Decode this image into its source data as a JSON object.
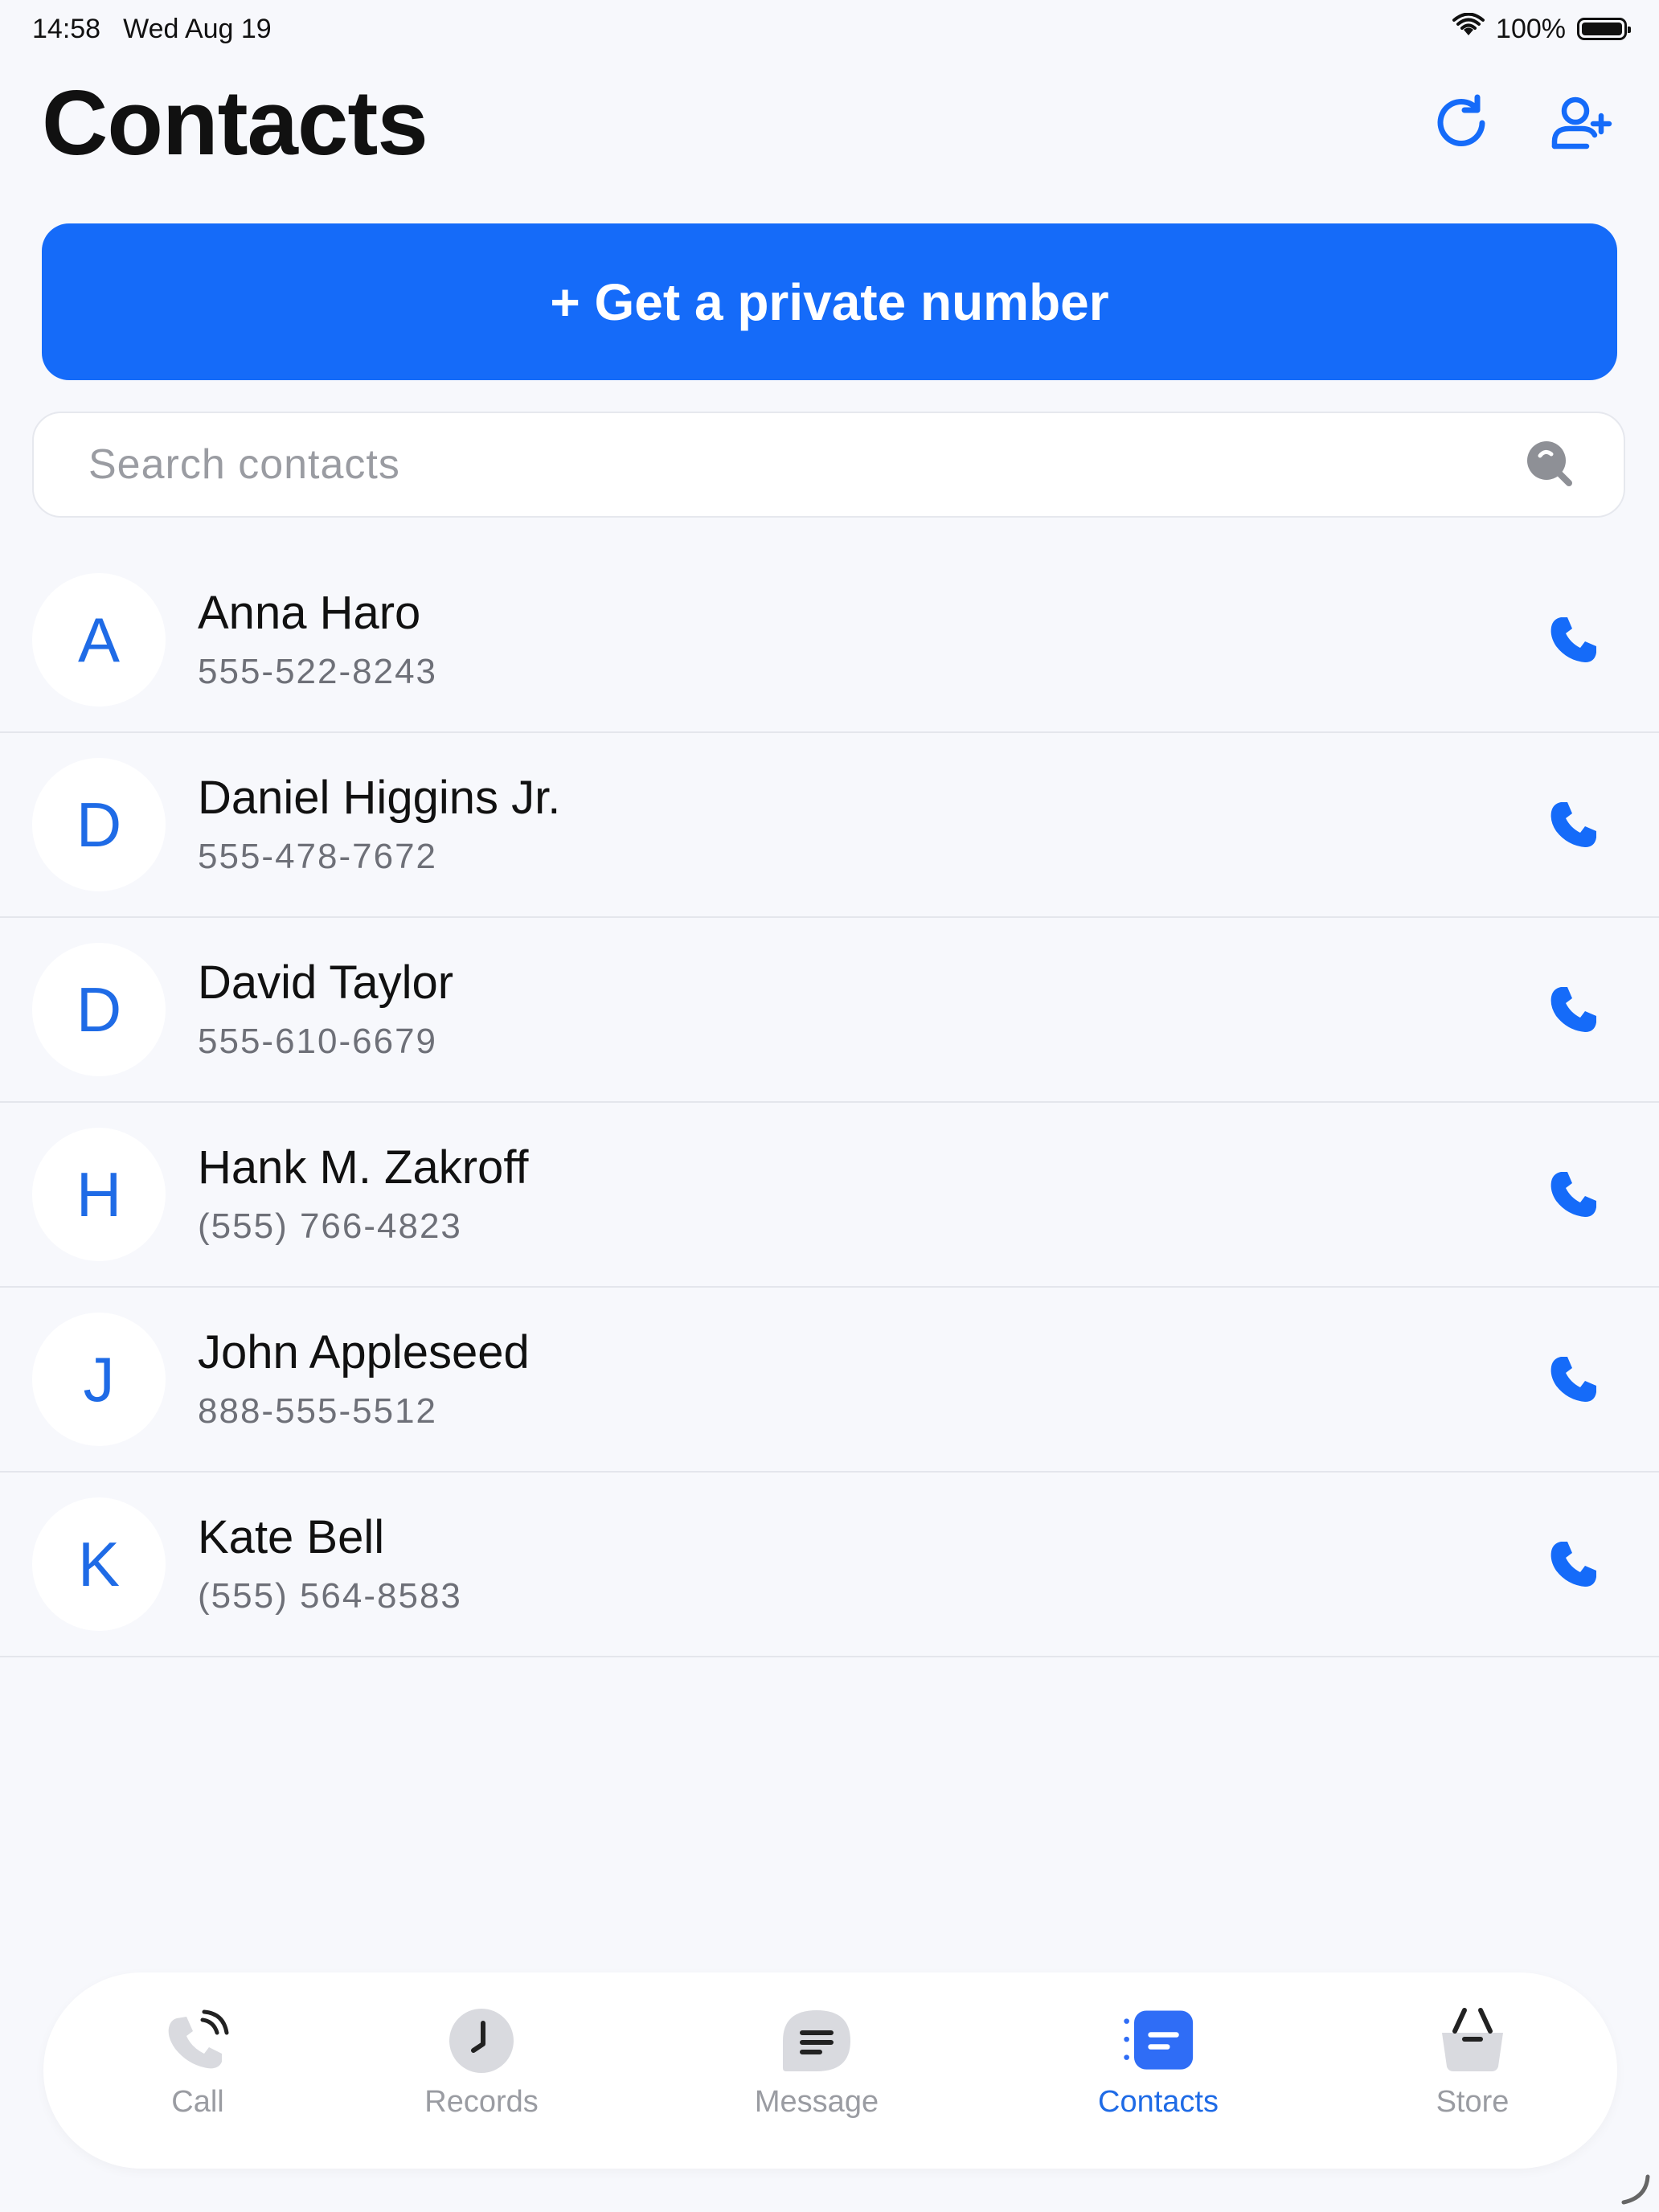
{
  "status_bar": {
    "time": "14:58",
    "date": "Wed Aug 19",
    "battery": "100%"
  },
  "header": {
    "title": "Contacts",
    "refresh_icon": "refresh-icon",
    "add_contact_icon": "add-user-icon"
  },
  "primary_action": {
    "label": "+ Get a private number"
  },
  "search": {
    "placeholder": "Search contacts",
    "value": ""
  },
  "contacts": [
    {
      "initial": "A",
      "name": "Anna Haro",
      "phone": "555-522-8243"
    },
    {
      "initial": "D",
      "name": "Daniel Higgins Jr.",
      "phone": "555-478-7672"
    },
    {
      "initial": "D",
      "name": "David Taylor",
      "phone": "555-610-6679"
    },
    {
      "initial": "H",
      "name": "Hank M. Zakroff",
      "phone": "(555) 766-4823"
    },
    {
      "initial": "J",
      "name": "John Appleseed",
      "phone": "888-555-5512"
    },
    {
      "initial": "K",
      "name": "Kate Bell",
      "phone": "(555) 564-8583"
    }
  ],
  "tabs": [
    {
      "label": "Call",
      "icon": "call-icon",
      "active": false
    },
    {
      "label": "Records",
      "icon": "clock-icon",
      "active": false
    },
    {
      "label": "Message",
      "icon": "message-icon",
      "active": false
    },
    {
      "label": "Contacts",
      "icon": "contacts-icon",
      "active": true
    },
    {
      "label": "Store",
      "icon": "basket-icon",
      "active": false
    }
  ],
  "colors": {
    "accent": "#156BF9",
    "background": "#F7F8FC",
    "inactive_tab": "#9A9CA2"
  }
}
